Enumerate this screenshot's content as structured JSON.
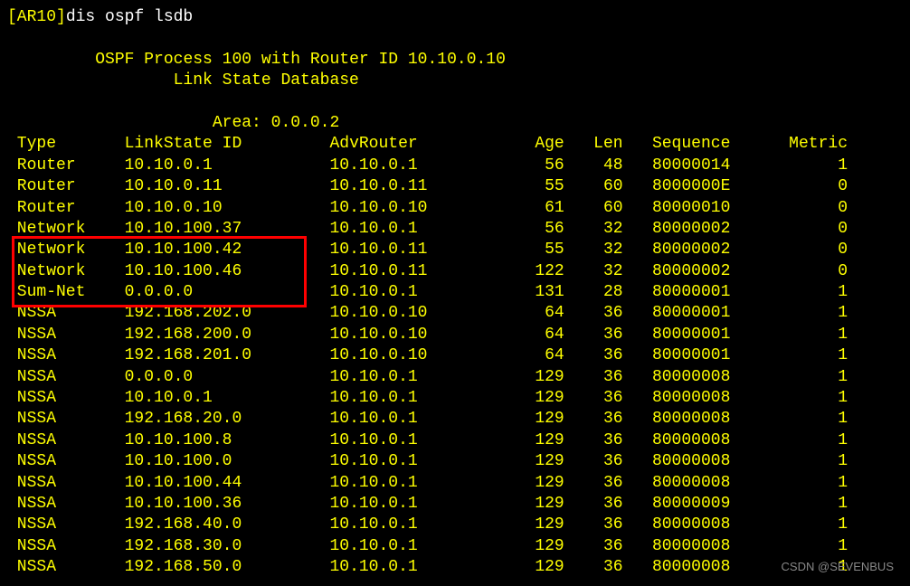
{
  "prompt": {
    "device": "[AR10]",
    "command": "dis ospf lsdb"
  },
  "header": {
    "process_line": "\t OSPF Process 100 with Router ID 10.10.0.10",
    "db_line": "\t\t Link State Database"
  },
  "area_line": "\t\t     Area: 0.0.0.2",
  "columns": {
    "type": "Type",
    "ls": "LinkState ID",
    "adv": "AdvRouter",
    "age": "Age",
    "len": "Len",
    "seq": "Sequence",
    "metric": "Metric"
  },
  "rows": [
    {
      "type": "Router",
      "ls": "10.10.0.1",
      "adv": "10.10.0.1",
      "age": "56",
      "len": "48",
      "seq": "80000014",
      "metric": "1"
    },
    {
      "type": "Router",
      "ls": "10.10.0.11",
      "adv": "10.10.0.11",
      "age": "55",
      "len": "60",
      "seq": "8000000E",
      "metric": "0"
    },
    {
      "type": "Router",
      "ls": "10.10.0.10",
      "adv": "10.10.0.10",
      "age": "61",
      "len": "60",
      "seq": "80000010",
      "metric": "0"
    },
    {
      "type": "Network",
      "ls": "10.10.100.37",
      "adv": "10.10.0.1",
      "age": "56",
      "len": "32",
      "seq": "80000002",
      "metric": "0"
    },
    {
      "type": "Network",
      "ls": "10.10.100.42",
      "adv": "10.10.0.11",
      "age": "55",
      "len": "32",
      "seq": "80000002",
      "metric": "0"
    },
    {
      "type": "Network",
      "ls": "10.10.100.46",
      "adv": "10.10.0.11",
      "age": "122",
      "len": "32",
      "seq": "80000002",
      "metric": "0"
    },
    {
      "type": "Sum-Net",
      "ls": "0.0.0.0",
      "adv": "10.10.0.1",
      "age": "131",
      "len": "28",
      "seq": "80000001",
      "metric": "1"
    },
    {
      "type": "NSSA",
      "ls": "192.168.202.0",
      "adv": "10.10.0.10",
      "age": "64",
      "len": "36",
      "seq": "80000001",
      "metric": "1"
    },
    {
      "type": "NSSA",
      "ls": "192.168.200.0",
      "adv": "10.10.0.10",
      "age": "64",
      "len": "36",
      "seq": "80000001",
      "metric": "1"
    },
    {
      "type": "NSSA",
      "ls": "192.168.201.0",
      "adv": "10.10.0.10",
      "age": "64",
      "len": "36",
      "seq": "80000001",
      "metric": "1"
    },
    {
      "type": "NSSA",
      "ls": "0.0.0.0",
      "adv": "10.10.0.1",
      "age": "129",
      "len": "36",
      "seq": "80000008",
      "metric": "1"
    },
    {
      "type": "NSSA",
      "ls": "10.10.0.1",
      "adv": "10.10.0.1",
      "age": "129",
      "len": "36",
      "seq": "80000008",
      "metric": "1"
    },
    {
      "type": "NSSA",
      "ls": "192.168.20.0",
      "adv": "10.10.0.1",
      "age": "129",
      "len": "36",
      "seq": "80000008",
      "metric": "1"
    },
    {
      "type": "NSSA",
      "ls": "10.10.100.8",
      "adv": "10.10.0.1",
      "age": "129",
      "len": "36",
      "seq": "80000008",
      "metric": "1"
    },
    {
      "type": "NSSA",
      "ls": "10.10.100.0",
      "adv": "10.10.0.1",
      "age": "129",
      "len": "36",
      "seq": "80000008",
      "metric": "1"
    },
    {
      "type": "NSSA",
      "ls": "10.10.100.44",
      "adv": "10.10.0.1",
      "age": "129",
      "len": "36",
      "seq": "80000008",
      "metric": "1"
    },
    {
      "type": "NSSA",
      "ls": "10.10.100.36",
      "adv": "10.10.0.1",
      "age": "129",
      "len": "36",
      "seq": "80000009",
      "metric": "1"
    },
    {
      "type": "NSSA",
      "ls": "192.168.40.0",
      "adv": "10.10.0.1",
      "age": "129",
      "len": "36",
      "seq": "80000008",
      "metric": "1"
    },
    {
      "type": "NSSA",
      "ls": "192.168.30.0",
      "adv": "10.10.0.1",
      "age": "129",
      "len": "36",
      "seq": "80000008",
      "metric": "1"
    },
    {
      "type": "NSSA",
      "ls": "192.168.50.0",
      "adv": "10.10.0.1",
      "age": "129",
      "len": "36",
      "seq": "80000008",
      "metric": "1"
    }
  ],
  "watermark": "CSDN @SEVENBUS"
}
